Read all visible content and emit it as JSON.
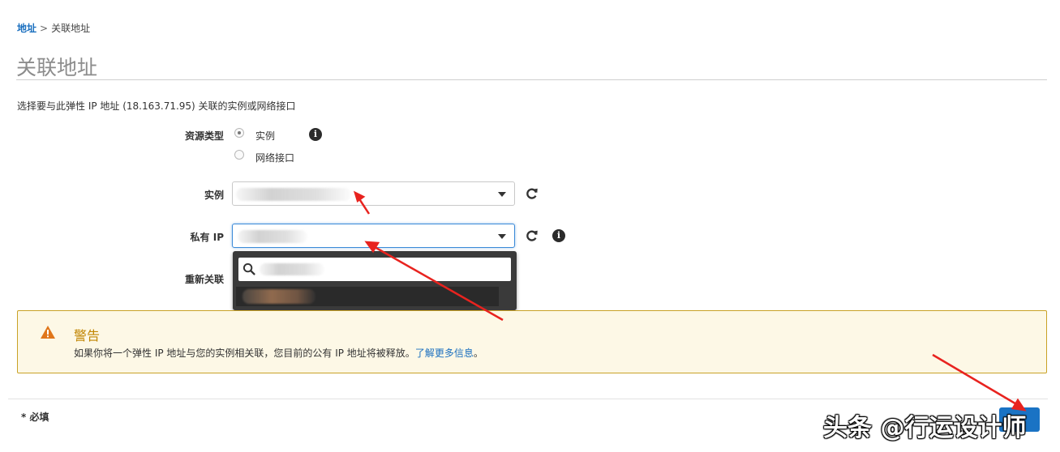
{
  "breadcrumb": {
    "link": "地址",
    "separator": ">",
    "current": "关联地址"
  },
  "page": {
    "title": "关联地址",
    "intro": "选择要与此弹性 IP 地址 (18.163.71.95) 关联的实例或网络接口"
  },
  "form": {
    "resource_type_label": "资源类型",
    "options": [
      {
        "label": "实例",
        "checked": true
      },
      {
        "label": "网络接口",
        "checked": false
      }
    ],
    "instance_label": "实例",
    "private_ip_label": "私有 IP",
    "reassociate_label": "重新关联"
  },
  "icons": {
    "info": "i",
    "refresh": "refresh-icon",
    "warning": "warning-triangle-icon",
    "search": "search-icon"
  },
  "warning": {
    "title": "警告",
    "body": "如果你将一个弹性 IP 地址与您的实例相关联，您目前的公有 IP 地址将被释放。",
    "link": "了解更多信息",
    "end": "。"
  },
  "footer": {
    "required": "* 必填"
  },
  "watermark": "头条 @行运设计师",
  "colors": {
    "accent": "#1a73c4",
    "link": "#1a6fbf",
    "warning_border": "#c9a227",
    "warning_title": "#c18500",
    "annotation_arrow": "#e8231f"
  }
}
